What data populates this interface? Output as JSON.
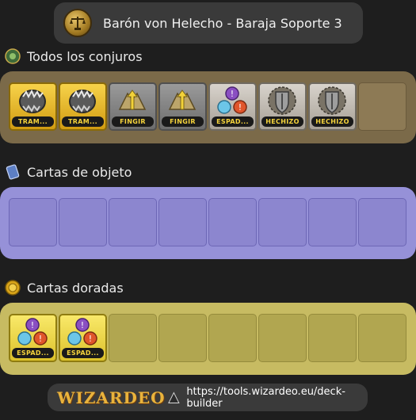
{
  "header": {
    "title": "Barón von Helecho - Baraja Soporte 3"
  },
  "sections": {
    "spells": {
      "title": "Todos los conjuros",
      "cards": [
        {
          "label": "TRAM...",
          "style": "gold",
          "icon": "trap-icon"
        },
        {
          "label": "TRAM...",
          "style": "gold",
          "icon": "trap-icon"
        },
        {
          "label": "FINGIR",
          "style": "grey",
          "icon": "feint-icon"
        },
        {
          "label": "FINGIR",
          "style": "grey",
          "icon": "feint-icon"
        },
        {
          "label": "ESPAD...",
          "style": "silver",
          "icon": "sword-icon"
        },
        {
          "label": "HECHIZO",
          "style": "silver",
          "icon": "shield-icon"
        },
        {
          "label": "HECHIZO",
          "style": "silver",
          "icon": "shield-icon"
        }
      ],
      "empty_slots": 1
    },
    "items": {
      "title": "Cartas de objeto",
      "cards": [],
      "empty_slots": 8
    },
    "gold": {
      "title": "Cartas doradas",
      "cards": [
        {
          "label": "ESPAD...",
          "style": "yellow",
          "icon": "sword-icon"
        },
        {
          "label": "ESPAD...",
          "style": "yellow",
          "icon": "sword-icon"
        }
      ],
      "empty_slots": 6
    }
  },
  "footer": {
    "logo": "WIZARDEO",
    "url": "https://tools.wizardeo.eu/deck-builder"
  },
  "colors": {
    "background": "#1e1e1e",
    "spells_panel": "#7b6a49",
    "items_panel": "#9691d8",
    "gold_panel": "#c7bb62",
    "pill": "#3a3a3a"
  }
}
